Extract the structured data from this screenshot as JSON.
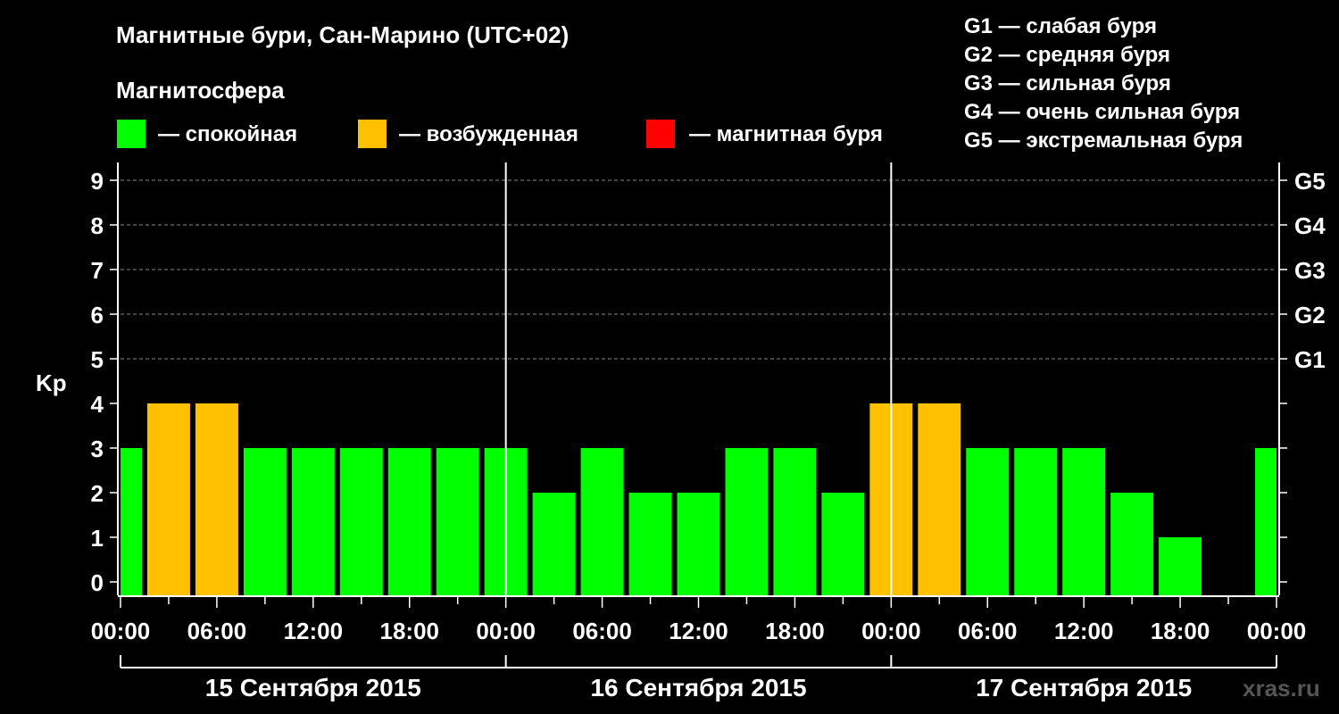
{
  "chart_data": {
    "type": "bar",
    "title": "Магнитные бури, Сан-Марино (UTC+02)",
    "subtitle": "Магнитосфера",
    "legend": [
      {
        "label": "— спокойная",
        "color": "#00ff00"
      },
      {
        "label": "— возбужденная",
        "color": "#ffc000"
      },
      {
        "label": "— магнитная буря",
        "color": "#ff0000"
      }
    ],
    "storm_scale": [
      "G1 — слабая буря",
      "G2 — средняя буря",
      "G3 — сильная буря",
      "G4 — очень сильная буря",
      "G5 — экстремальная буря"
    ],
    "ylabel": "Kp",
    "ylim": [
      0,
      9
    ],
    "y_ticks": [
      "0",
      "1",
      "2",
      "3",
      "4",
      "5",
      "6",
      "7",
      "8",
      "9"
    ],
    "right_ticks": [
      {
        "kp": 5,
        "label": "G1"
      },
      {
        "kp": 6,
        "label": "G2"
      },
      {
        "kp": 7,
        "label": "G3"
      },
      {
        "kp": 8,
        "label": "G4"
      },
      {
        "kp": 9,
        "label": "G5"
      }
    ],
    "x_ticks": [
      "00:00",
      "06:00",
      "12:00",
      "18:00",
      "00:00",
      "06:00",
      "12:00",
      "18:00",
      "00:00",
      "06:00",
      "12:00",
      "18:00",
      "00:00"
    ],
    "days": [
      "15 Сентября 2015",
      "16 Сентября 2015",
      "17 Сентября 2015"
    ],
    "x_range_hours": [
      0,
      72
    ],
    "bars": [
      {
        "start": 0,
        "end": 1.5,
        "value": 3
      },
      {
        "start": 1.5,
        "end": 4.5,
        "value": 4
      },
      {
        "start": 4.5,
        "end": 7.5,
        "value": 4
      },
      {
        "start": 7.5,
        "end": 10.5,
        "value": 3
      },
      {
        "start": 10.5,
        "end": 13.5,
        "value": 3
      },
      {
        "start": 13.5,
        "end": 16.5,
        "value": 3
      },
      {
        "start": 16.5,
        "end": 19.5,
        "value": 3
      },
      {
        "start": 19.5,
        "end": 22.5,
        "value": 3
      },
      {
        "start": 22.5,
        "end": 25.5,
        "value": 3
      },
      {
        "start": 25.5,
        "end": 28.5,
        "value": 2
      },
      {
        "start": 28.5,
        "end": 31.5,
        "value": 3
      },
      {
        "start": 31.5,
        "end": 34.5,
        "value": 2
      },
      {
        "start": 34.5,
        "end": 37.5,
        "value": 2
      },
      {
        "start": 37.5,
        "end": 40.5,
        "value": 3
      },
      {
        "start": 40.5,
        "end": 43.5,
        "value": 3
      },
      {
        "start": 43.5,
        "end": 46.5,
        "value": 2
      },
      {
        "start": 46.5,
        "end": 49.5,
        "value": 4
      },
      {
        "start": 49.5,
        "end": 52.5,
        "value": 4
      },
      {
        "start": 52.5,
        "end": 55.5,
        "value": 3
      },
      {
        "start": 55.5,
        "end": 58.5,
        "value": 3
      },
      {
        "start": 58.5,
        "end": 61.5,
        "value": 3
      },
      {
        "start": 61.5,
        "end": 64.5,
        "value": 2
      },
      {
        "start": 64.5,
        "end": 67.5,
        "value": 1
      },
      {
        "start": 70.5,
        "end": 72,
        "value": 3
      }
    ],
    "grid": "dashed at Kp 5–9",
    "watermark": "xras.ru"
  }
}
